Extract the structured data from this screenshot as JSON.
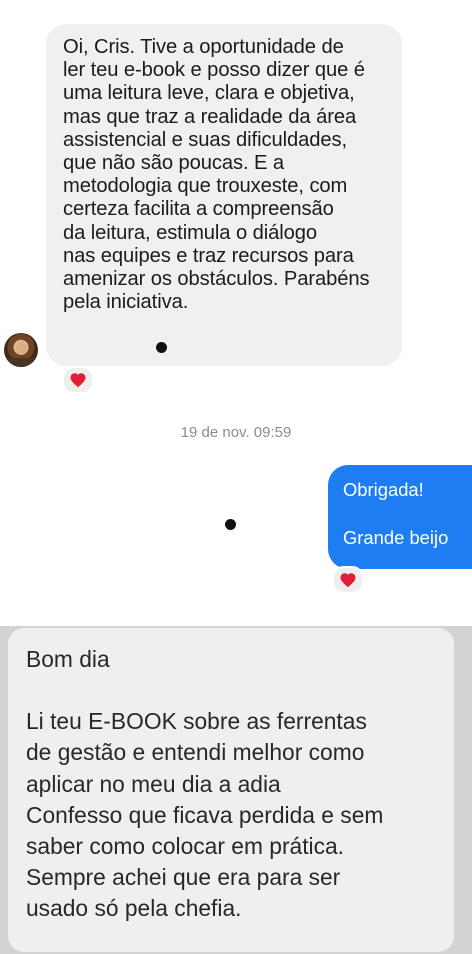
{
  "messages": {
    "first_incoming": {
      "text": "Oi, Cris. Tive a oportunidade de\nler teu e-book e posso dizer que é\numa leitura leve, clara e objetiva,\nmas que traz a realidade da área\nassistencial e suas dificuldades,\nque não são poucas. E a\nmetodologia que trouxeste, com\ncerteza facilita a compreensão\nda leitura, estimula o diálogo\nnas equipes e traz recursos para\namenizar os obstáculos. Parabéns\npela iniciativa.",
      "reaction_icon": "heart-icon"
    },
    "timestamp": "19 de nov. 09:59",
    "outgoing": {
      "line1": "Obrigada!",
      "line2": "Grande beijo",
      "reaction_icon": "heart-icon"
    },
    "second_incoming": {
      "greeting": "Bom dia",
      "body": "Li teu E-BOOK sobre as ferrentas\nde gestão e entendi melhor como\naplicar no meu dia a adia\nConfesso que ficava perdida e sem\nsaber como colocar em prática.\nSempre achei que era para ser\nusado só pela chefia."
    }
  },
  "colors": {
    "incoming_bubble": "#f0f0f0",
    "outgoing_bubble": "#1f7df3",
    "timestamp": "#8c8c8c",
    "heart": "#e21d36"
  }
}
